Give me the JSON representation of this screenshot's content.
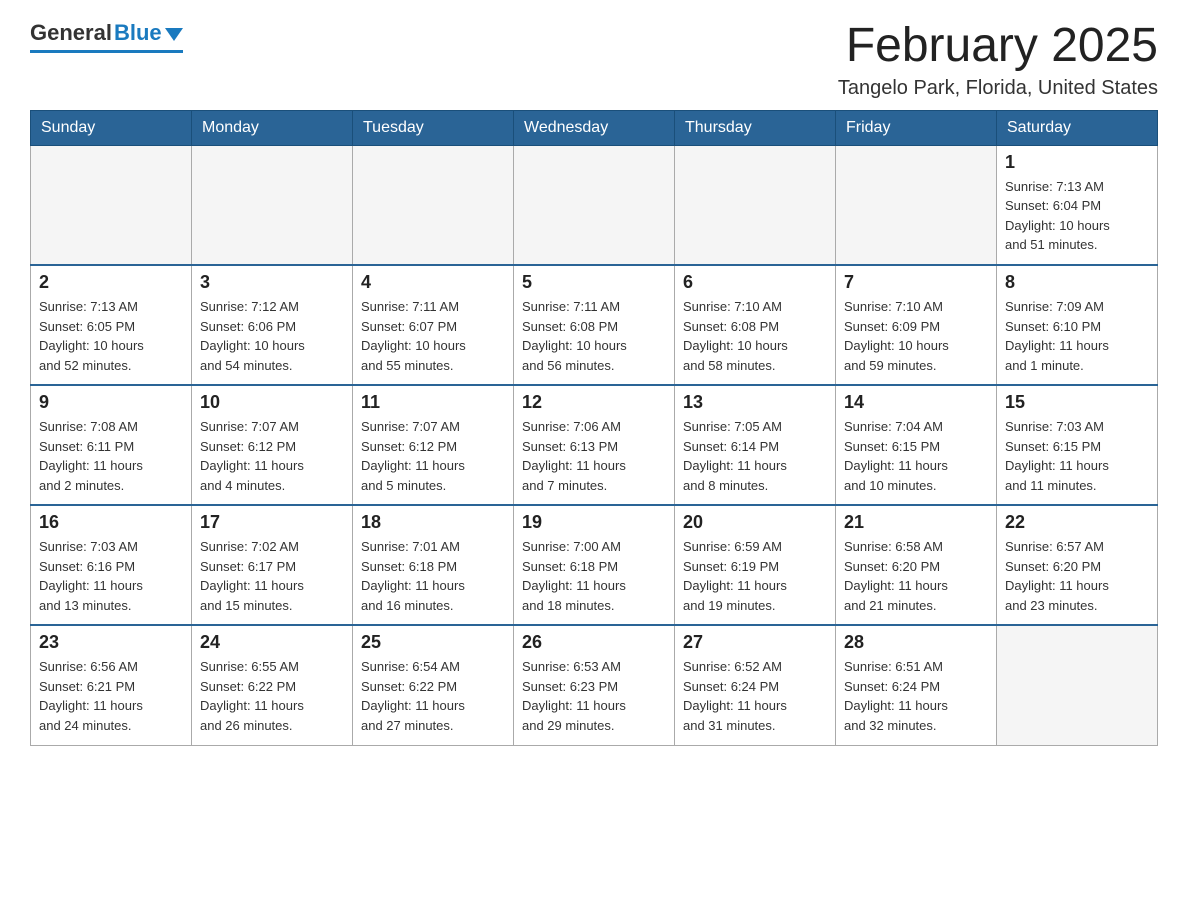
{
  "header": {
    "logo_general": "General",
    "logo_blue": "Blue",
    "title": "February 2025",
    "subtitle": "Tangelo Park, Florida, United States"
  },
  "weekdays": [
    "Sunday",
    "Monday",
    "Tuesday",
    "Wednesday",
    "Thursday",
    "Friday",
    "Saturday"
  ],
  "weeks": [
    [
      {
        "day": "",
        "info": ""
      },
      {
        "day": "",
        "info": ""
      },
      {
        "day": "",
        "info": ""
      },
      {
        "day": "",
        "info": ""
      },
      {
        "day": "",
        "info": ""
      },
      {
        "day": "",
        "info": ""
      },
      {
        "day": "1",
        "info": "Sunrise: 7:13 AM\nSunset: 6:04 PM\nDaylight: 10 hours\nand 51 minutes."
      }
    ],
    [
      {
        "day": "2",
        "info": "Sunrise: 7:13 AM\nSunset: 6:05 PM\nDaylight: 10 hours\nand 52 minutes."
      },
      {
        "day": "3",
        "info": "Sunrise: 7:12 AM\nSunset: 6:06 PM\nDaylight: 10 hours\nand 54 minutes."
      },
      {
        "day": "4",
        "info": "Sunrise: 7:11 AM\nSunset: 6:07 PM\nDaylight: 10 hours\nand 55 minutes."
      },
      {
        "day": "5",
        "info": "Sunrise: 7:11 AM\nSunset: 6:08 PM\nDaylight: 10 hours\nand 56 minutes."
      },
      {
        "day": "6",
        "info": "Sunrise: 7:10 AM\nSunset: 6:08 PM\nDaylight: 10 hours\nand 58 minutes."
      },
      {
        "day": "7",
        "info": "Sunrise: 7:10 AM\nSunset: 6:09 PM\nDaylight: 10 hours\nand 59 minutes."
      },
      {
        "day": "8",
        "info": "Sunrise: 7:09 AM\nSunset: 6:10 PM\nDaylight: 11 hours\nand 1 minute."
      }
    ],
    [
      {
        "day": "9",
        "info": "Sunrise: 7:08 AM\nSunset: 6:11 PM\nDaylight: 11 hours\nand 2 minutes."
      },
      {
        "day": "10",
        "info": "Sunrise: 7:07 AM\nSunset: 6:12 PM\nDaylight: 11 hours\nand 4 minutes."
      },
      {
        "day": "11",
        "info": "Sunrise: 7:07 AM\nSunset: 6:12 PM\nDaylight: 11 hours\nand 5 minutes."
      },
      {
        "day": "12",
        "info": "Sunrise: 7:06 AM\nSunset: 6:13 PM\nDaylight: 11 hours\nand 7 minutes."
      },
      {
        "day": "13",
        "info": "Sunrise: 7:05 AM\nSunset: 6:14 PM\nDaylight: 11 hours\nand 8 minutes."
      },
      {
        "day": "14",
        "info": "Sunrise: 7:04 AM\nSunset: 6:15 PM\nDaylight: 11 hours\nand 10 minutes."
      },
      {
        "day": "15",
        "info": "Sunrise: 7:03 AM\nSunset: 6:15 PM\nDaylight: 11 hours\nand 11 minutes."
      }
    ],
    [
      {
        "day": "16",
        "info": "Sunrise: 7:03 AM\nSunset: 6:16 PM\nDaylight: 11 hours\nand 13 minutes."
      },
      {
        "day": "17",
        "info": "Sunrise: 7:02 AM\nSunset: 6:17 PM\nDaylight: 11 hours\nand 15 minutes."
      },
      {
        "day": "18",
        "info": "Sunrise: 7:01 AM\nSunset: 6:18 PM\nDaylight: 11 hours\nand 16 minutes."
      },
      {
        "day": "19",
        "info": "Sunrise: 7:00 AM\nSunset: 6:18 PM\nDaylight: 11 hours\nand 18 minutes."
      },
      {
        "day": "20",
        "info": "Sunrise: 6:59 AM\nSunset: 6:19 PM\nDaylight: 11 hours\nand 19 minutes."
      },
      {
        "day": "21",
        "info": "Sunrise: 6:58 AM\nSunset: 6:20 PM\nDaylight: 11 hours\nand 21 minutes."
      },
      {
        "day": "22",
        "info": "Sunrise: 6:57 AM\nSunset: 6:20 PM\nDaylight: 11 hours\nand 23 minutes."
      }
    ],
    [
      {
        "day": "23",
        "info": "Sunrise: 6:56 AM\nSunset: 6:21 PM\nDaylight: 11 hours\nand 24 minutes."
      },
      {
        "day": "24",
        "info": "Sunrise: 6:55 AM\nSunset: 6:22 PM\nDaylight: 11 hours\nand 26 minutes."
      },
      {
        "day": "25",
        "info": "Sunrise: 6:54 AM\nSunset: 6:22 PM\nDaylight: 11 hours\nand 27 minutes."
      },
      {
        "day": "26",
        "info": "Sunrise: 6:53 AM\nSunset: 6:23 PM\nDaylight: 11 hours\nand 29 minutes."
      },
      {
        "day": "27",
        "info": "Sunrise: 6:52 AM\nSunset: 6:24 PM\nDaylight: 11 hours\nand 31 minutes."
      },
      {
        "day": "28",
        "info": "Sunrise: 6:51 AM\nSunset: 6:24 PM\nDaylight: 11 hours\nand 32 minutes."
      },
      {
        "day": "",
        "info": ""
      }
    ]
  ]
}
